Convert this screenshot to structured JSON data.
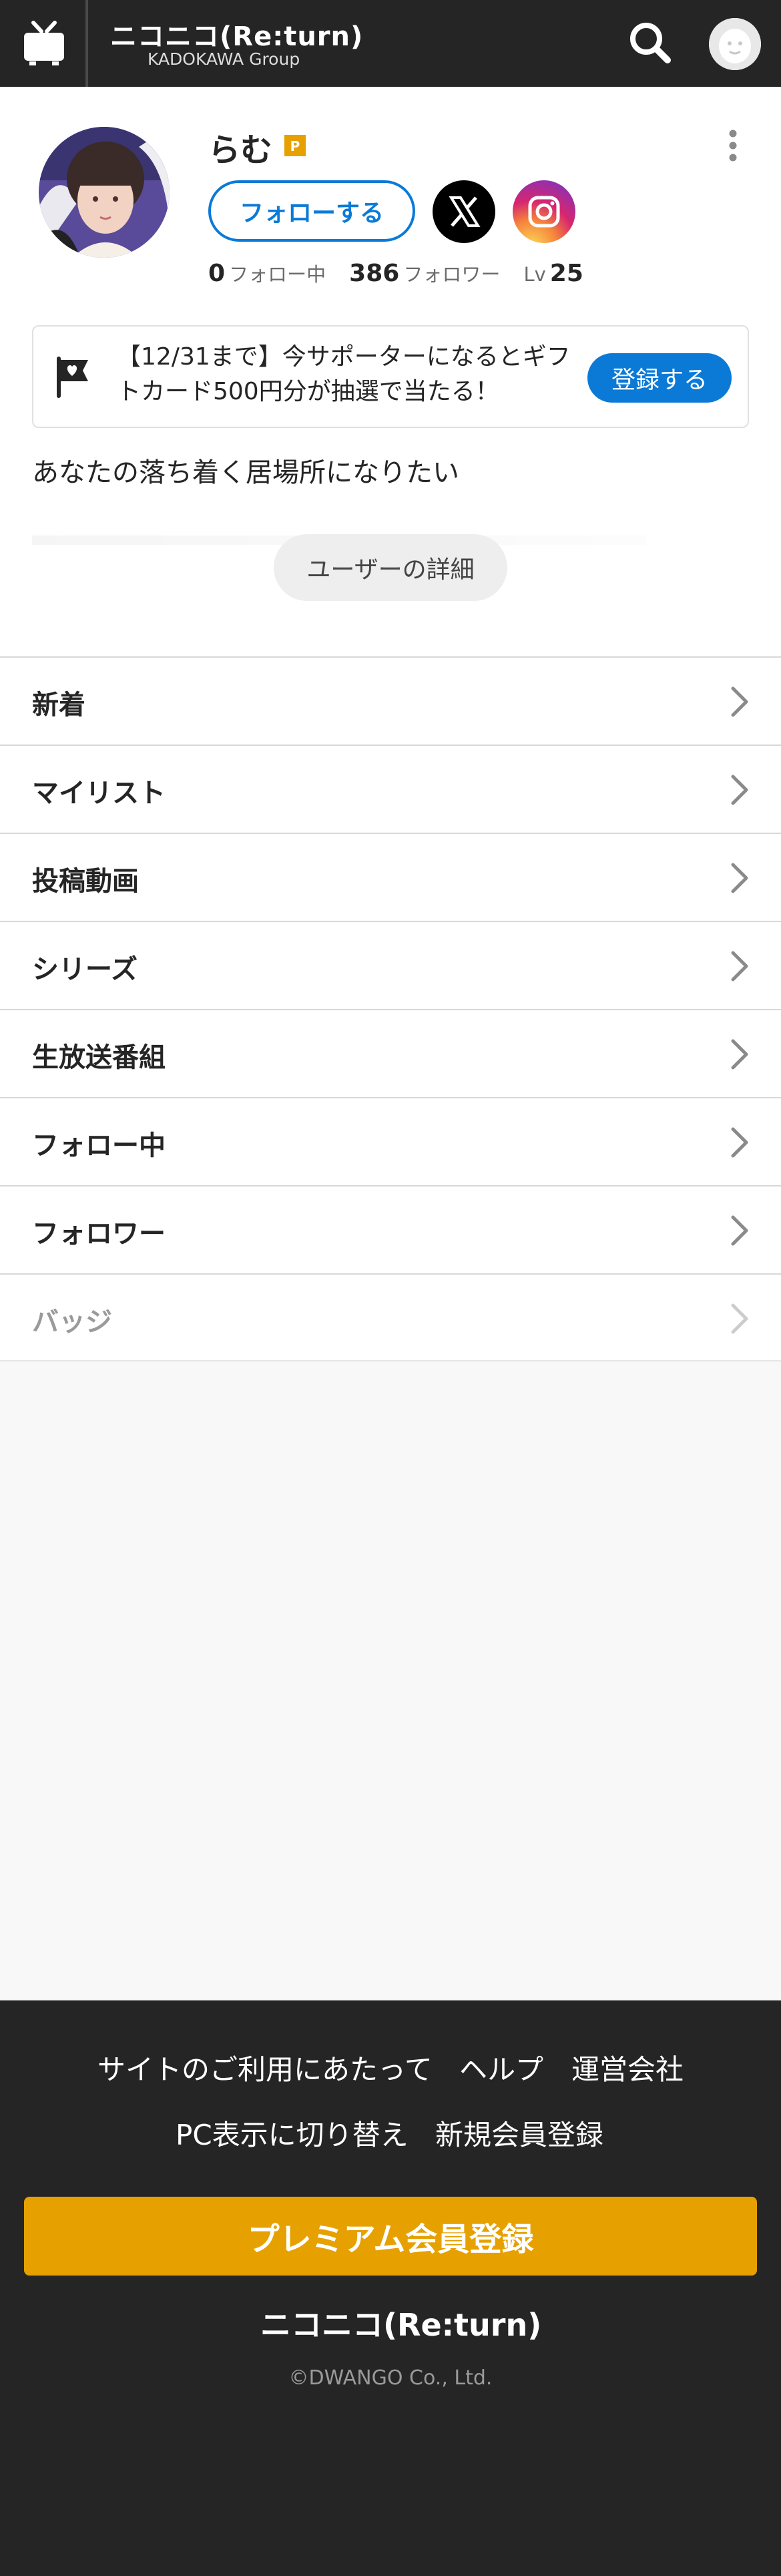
{
  "header": {
    "logo_main": "ニコニコ(Re:turn)",
    "logo_sub": "KADOKAWA Group"
  },
  "profile": {
    "name": "らむ",
    "premium_badge": "P",
    "follow_label": "フォローする",
    "following_count": "0",
    "following_label": "フォロー中",
    "followers_count": "386",
    "followers_label": "フォロワー",
    "level_label": "Lv",
    "level_value": "25",
    "bio": "あなたの落ち着く居場所になりたい",
    "detail_label": "ユーザーの詳細"
  },
  "banner": {
    "text": "【12/31まで】今サポーターになるとギフトカード500円分が抽選で当たる！",
    "button_label": "登録する"
  },
  "menu": [
    {
      "label": "新着",
      "enabled": true
    },
    {
      "label": "マイリスト",
      "enabled": true
    },
    {
      "label": "投稿動画",
      "enabled": true
    },
    {
      "label": "シリーズ",
      "enabled": true
    },
    {
      "label": "生放送番組",
      "enabled": true
    },
    {
      "label": "フォロー中",
      "enabled": true
    },
    {
      "label": "フォロワー",
      "enabled": true
    },
    {
      "label": "バッジ",
      "enabled": false
    }
  ],
  "footer": {
    "terms_label": "サイトのご利用にあたって",
    "help_label": "ヘルプ",
    "company_label": "運営会社",
    "pc_view_label": "PC表示に切り替え",
    "signup_label": "新規会員登録",
    "premium_label": "プレミアム会員登録",
    "logo": "ニコニコ(Re:turn)",
    "copyright": "©DWANGO Co., Ltd."
  },
  "icons": {
    "home": "tv-icon",
    "search": "search-icon",
    "account": "user-avatar-icon",
    "more": "more-vertical-icon",
    "x": "x-logo-icon",
    "instagram": "instagram-icon",
    "banner_flag": "flag-heart-icon",
    "chevron": "chevron-right-icon"
  },
  "colors": {
    "header_bg": "#252525",
    "accent_blue": "#0b7ad7",
    "premium_gold": "#e6a100",
    "page_bg": "#f8f8f8"
  }
}
